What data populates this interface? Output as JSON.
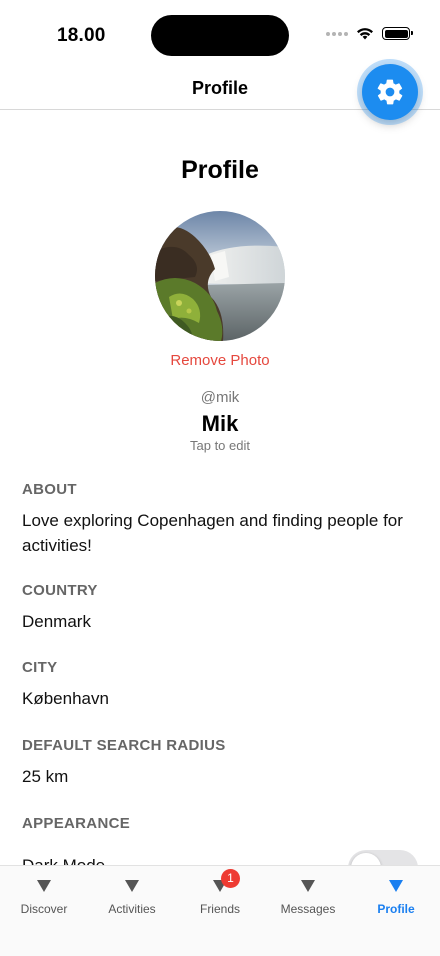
{
  "status_bar": {
    "time": "18.00"
  },
  "nav": {
    "title": "Profile"
  },
  "settings_button": {
    "icon": "gear-icon",
    "color": "#1c8cf0"
  },
  "profile": {
    "heading": "Profile",
    "remove_photo": "Remove Photo",
    "username": "@mik",
    "display_name": "Mik",
    "tap_to_edit": "Tap to edit"
  },
  "sections": {
    "about": {
      "label": "ABOUT",
      "value": "Love exploring Copenhagen and finding people for activities!"
    },
    "country": {
      "label": "COUNTRY",
      "value": "Denmark"
    },
    "city": {
      "label": "CITY",
      "value": "København"
    },
    "radius": {
      "label": "DEFAULT SEARCH RADIUS",
      "value": "25 km"
    },
    "appearance": {
      "label": "APPEARANCE",
      "dark_mode_label": "Dark Mode",
      "dark_mode_on": false
    }
  },
  "tabs": [
    {
      "label": "Discover",
      "icon": "triangle-down-icon",
      "active": false
    },
    {
      "label": "Activities",
      "icon": "triangle-down-icon",
      "active": false
    },
    {
      "label": "Friends",
      "icon": "triangle-down-icon",
      "active": false,
      "badge": "1"
    },
    {
      "label": "Messages",
      "icon": "triangle-down-icon",
      "active": false
    },
    {
      "label": "Profile",
      "icon": "triangle-down-icon",
      "active": true
    }
  ],
  "colors": {
    "accent": "#1a7ff0",
    "destructive": "#e5483e",
    "badge": "#ee3a32"
  }
}
